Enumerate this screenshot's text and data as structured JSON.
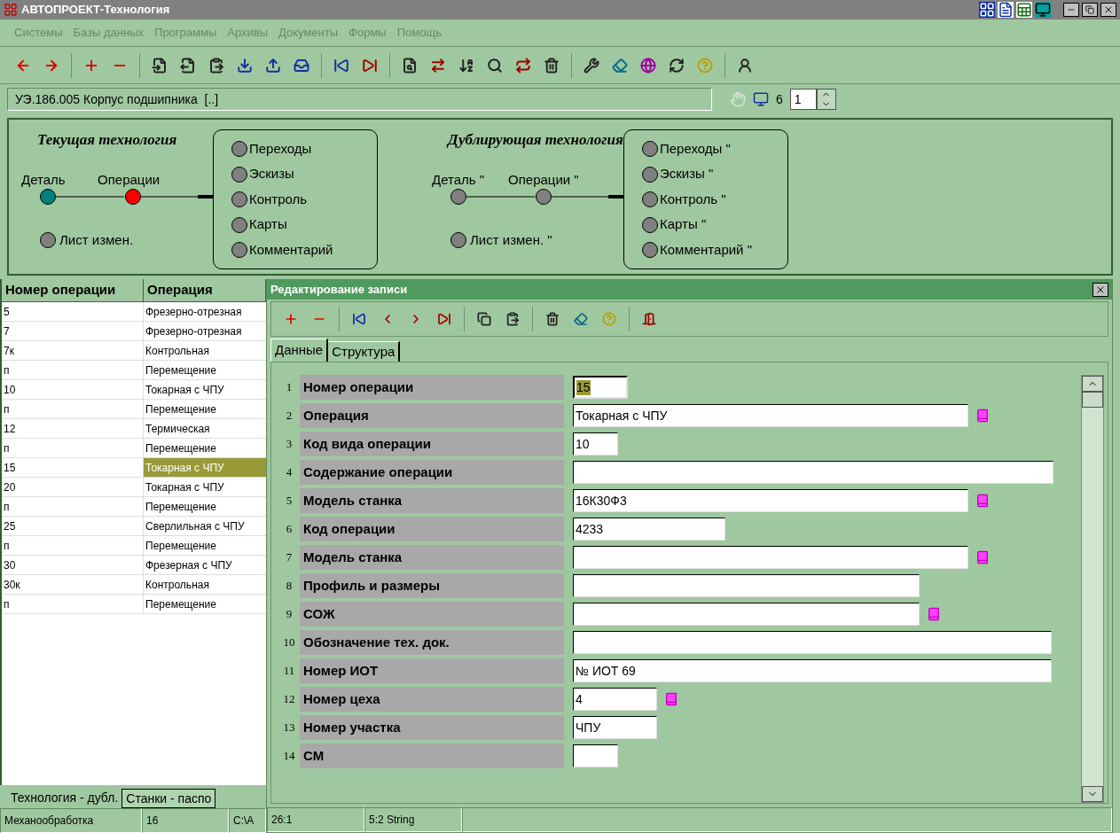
{
  "window": {
    "title": "АВТОПРОЕКТ-Технология"
  },
  "menu": [
    "Системы",
    "Базы данных",
    "Программы",
    "Архивы",
    "Документы",
    "Формы",
    "Помощь"
  ],
  "path_bar": {
    "text": "УЭ.186.005 Корпус подшипника  [..]",
    "count": "6",
    "spin_value": "1"
  },
  "diagram": [
    {
      "title": "Текущая технология",
      "chain": [
        {
          "label": "Деталь",
          "color": "#008080"
        },
        {
          "label": "Операции",
          "color": "#ff0000"
        }
      ],
      "change_sheet": {
        "label": "Лист измен.",
        "color": "#808080"
      },
      "items": [
        {
          "label": "Переходы",
          "color": "#808080"
        },
        {
          "label": "Эскизы",
          "color": "#808080"
        },
        {
          "label": "Контроль",
          "color": "#808080"
        },
        {
          "label": "Карты",
          "color": "#808080"
        },
        {
          "label": "Комментарий",
          "color": "#808080"
        }
      ]
    },
    {
      "title": "Дублирующая технология",
      "chain": [
        {
          "label": "Деталь \"",
          "color": "#808080"
        },
        {
          "label": "Операции \"",
          "color": "#808080"
        }
      ],
      "change_sheet": {
        "label": "Лист измен. \"",
        "color": "#808080"
      },
      "items": [
        {
          "label": "Переходы \"",
          "color": "#808080"
        },
        {
          "label": "Эскизы \"",
          "color": "#808080"
        },
        {
          "label": "Контроль \"",
          "color": "#808080"
        },
        {
          "label": "Карты \"",
          "color": "#808080"
        },
        {
          "label": "Комментарий \"",
          "color": "#808080"
        }
      ]
    }
  ],
  "table": {
    "columns": [
      "Номер операции",
      "Операция"
    ],
    "rows": [
      {
        "number": "5",
        "operation": "Фрезерно-отрезная",
        "selected": false
      },
      {
        "number": "7",
        "operation": "Фрезерно-отрезная",
        "selected": false
      },
      {
        "number": "7к",
        "operation": "Контрольная",
        "selected": false
      },
      {
        "number": "п",
        "operation": "Перемещение",
        "selected": false
      },
      {
        "number": "10",
        "operation": "Токарная с ЧПУ",
        "selected": false
      },
      {
        "number": "п",
        "operation": "Перемещение",
        "selected": false
      },
      {
        "number": "12",
        "operation": "Термическая",
        "selected": false
      },
      {
        "number": "п",
        "operation": "Перемещение",
        "selected": false
      },
      {
        "number": "15",
        "operation": "Токарная с ЧПУ",
        "selected": true
      },
      {
        "number": "20",
        "operation": "Токарная с ЧПУ",
        "selected": false
      },
      {
        "number": "п",
        "operation": "Перемещение",
        "selected": false
      },
      {
        "number": "25",
        "operation": "Сверлильная с ЧПУ",
        "selected": false
      },
      {
        "number": "п",
        "operation": "Перемещение",
        "selected": false
      },
      {
        "number": "30",
        "operation": "Фрезерная с ЧПУ",
        "selected": false
      },
      {
        "number": "30к",
        "operation": "Контрольная",
        "selected": false
      },
      {
        "number": "п",
        "operation": "Перемещение",
        "selected": false
      }
    ]
  },
  "bottom_tabs": [
    {
      "label": "Технология - дубл.",
      "selected": true
    },
    {
      "label": "Станки - паспо",
      "selected": false
    }
  ],
  "status_bar": [
    "Механообработка",
    "16",
    "C:\\A"
  ],
  "dialog": {
    "title": "Редактирование записи",
    "tabs": [
      {
        "label": "Данные",
        "selected": true
      },
      {
        "label": "Структура",
        "selected": false
      }
    ],
    "fields": [
      {
        "index": "1",
        "label": "Номер операции",
        "value": "15",
        "focused": true,
        "lookup": false
      },
      {
        "index": "2",
        "label": "Операция",
        "value": "Токарная с ЧПУ",
        "focused": false,
        "lookup": true
      },
      {
        "index": "3",
        "label": "Код вида операции",
        "value": "10",
        "focused": false,
        "lookup": false
      },
      {
        "index": "4",
        "label": "Содержание операции",
        "focused": false,
        "lookup": false
      },
      {
        "index": "5",
        "label": "Модель станка",
        "value": "16К30Ф3",
        "focused": false,
        "lookup": true
      },
      {
        "index": "6",
        "label": "Код операции",
        "value": "4233",
        "focused": false,
        "lookup": false
      },
      {
        "index": "7",
        "label": "Модель станка",
        "focused": false,
        "lookup": true
      },
      {
        "index": "8",
        "label": "Профиль и размеры",
        "focused": false,
        "lookup": false
      },
      {
        "index": "9",
        "label": "СОЖ",
        "focused": false,
        "lookup": true
      },
      {
        "index": "10",
        "label": "Обозначение тех. док.",
        "focused": false,
        "lookup": false
      },
      {
        "index": "11",
        "label": "Номер ИОТ",
        "value": "№ ИОТ 69",
        "focused": false,
        "lookup": false
      },
      {
        "index": "12",
        "label": "Номер цеха",
        "value": "4",
        "focused": false,
        "lookup": true
      },
      {
        "index": "13",
        "label": "Номер участка",
        "value": "ЧПУ",
        "focused": false,
        "lookup": false
      },
      {
        "index": "14",
        "label": "СМ",
        "focused": false,
        "lookup": false
      }
    ],
    "status_bar": [
      "26:1",
      "5:2 String"
    ]
  }
}
